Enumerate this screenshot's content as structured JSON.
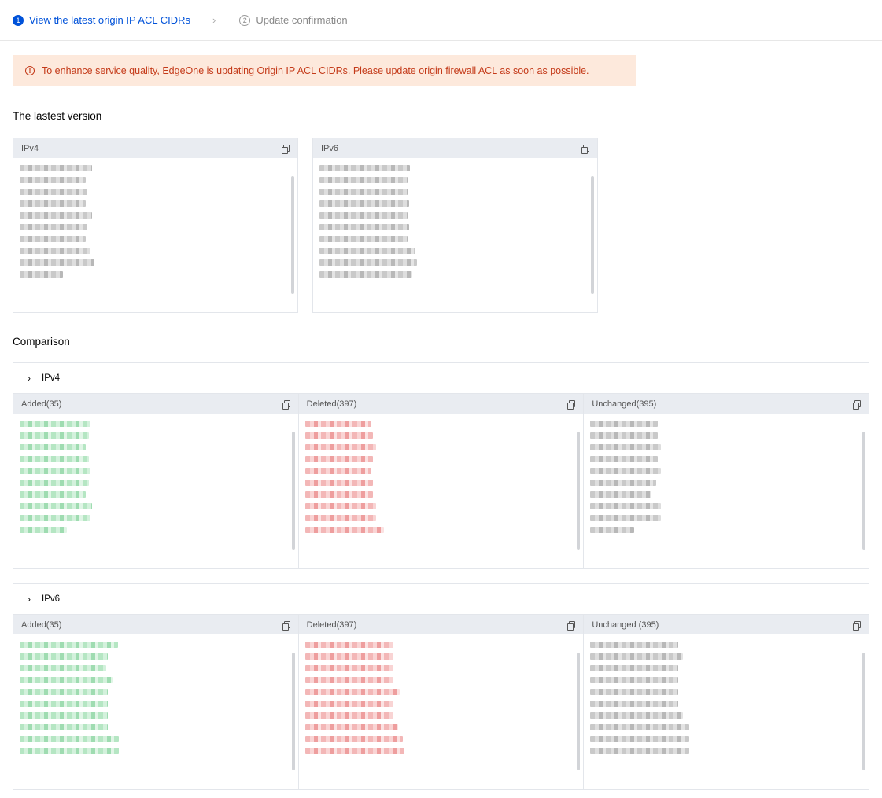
{
  "steps": [
    {
      "num": "1",
      "label": "View the latest origin IP ACL CIDRs",
      "active": true
    },
    {
      "num": "2",
      "label": "Update confirmation",
      "active": false
    }
  ],
  "step_separator": "›",
  "alert": {
    "icon": "!",
    "text": "To enhance service quality, EdgeOne is updating Origin IP ACL CIDRs. Please update origin firewall ACL as soon as possible."
  },
  "latest": {
    "title": "The lastest version",
    "ipv4_label": "IPv4",
    "ipv6_label": "IPv6"
  },
  "comparison": {
    "title": "Comparison",
    "ipv4": {
      "label": "IPv4",
      "added": "Added(35)",
      "deleted": "Deleted(397)",
      "unchanged": "Unchanged(395)"
    },
    "ipv6": {
      "label": "IPv6",
      "added": "Added(35)",
      "deleted": "Deleted(397)",
      "unchanged": "Unchanged (395)"
    }
  },
  "colors": {
    "primary": "#0052d9",
    "alert_bg": "#fde9dc",
    "alert_text": "#c43a19",
    "added": "#9fdcb1",
    "deleted": "#ee9e9e"
  }
}
